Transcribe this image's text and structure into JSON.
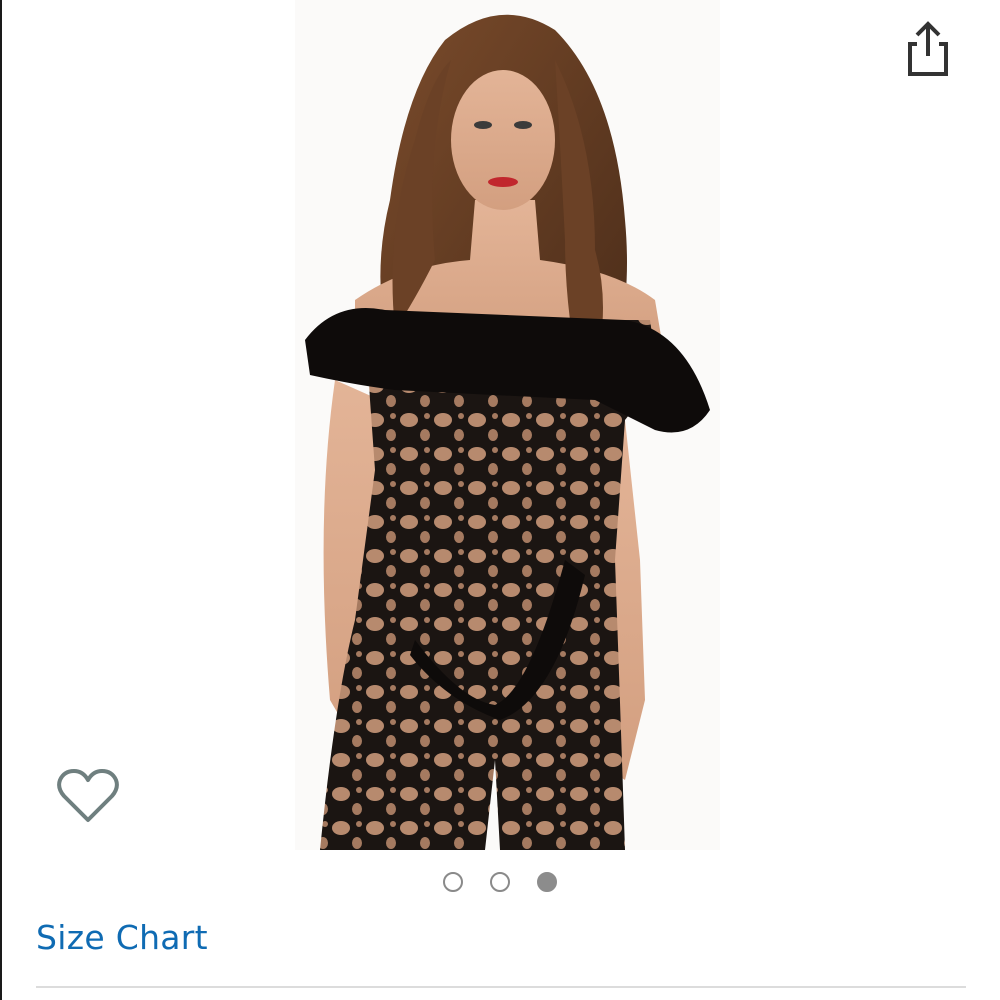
{
  "header": {
    "share_icon": "share-icon"
  },
  "gallery": {
    "image_subject": "product-photo",
    "wishlist_icon": "heart-outline-icon",
    "page_count": 3,
    "active_page": 3
  },
  "links": {
    "size_chart_label": "Size Chart"
  },
  "colors": {
    "link": "#0f6bb3",
    "dot_active": "#8c8c8c",
    "dot_inactive_border": "#8a8a8a",
    "icon": "#333333",
    "heart": "#6f7f7f"
  }
}
